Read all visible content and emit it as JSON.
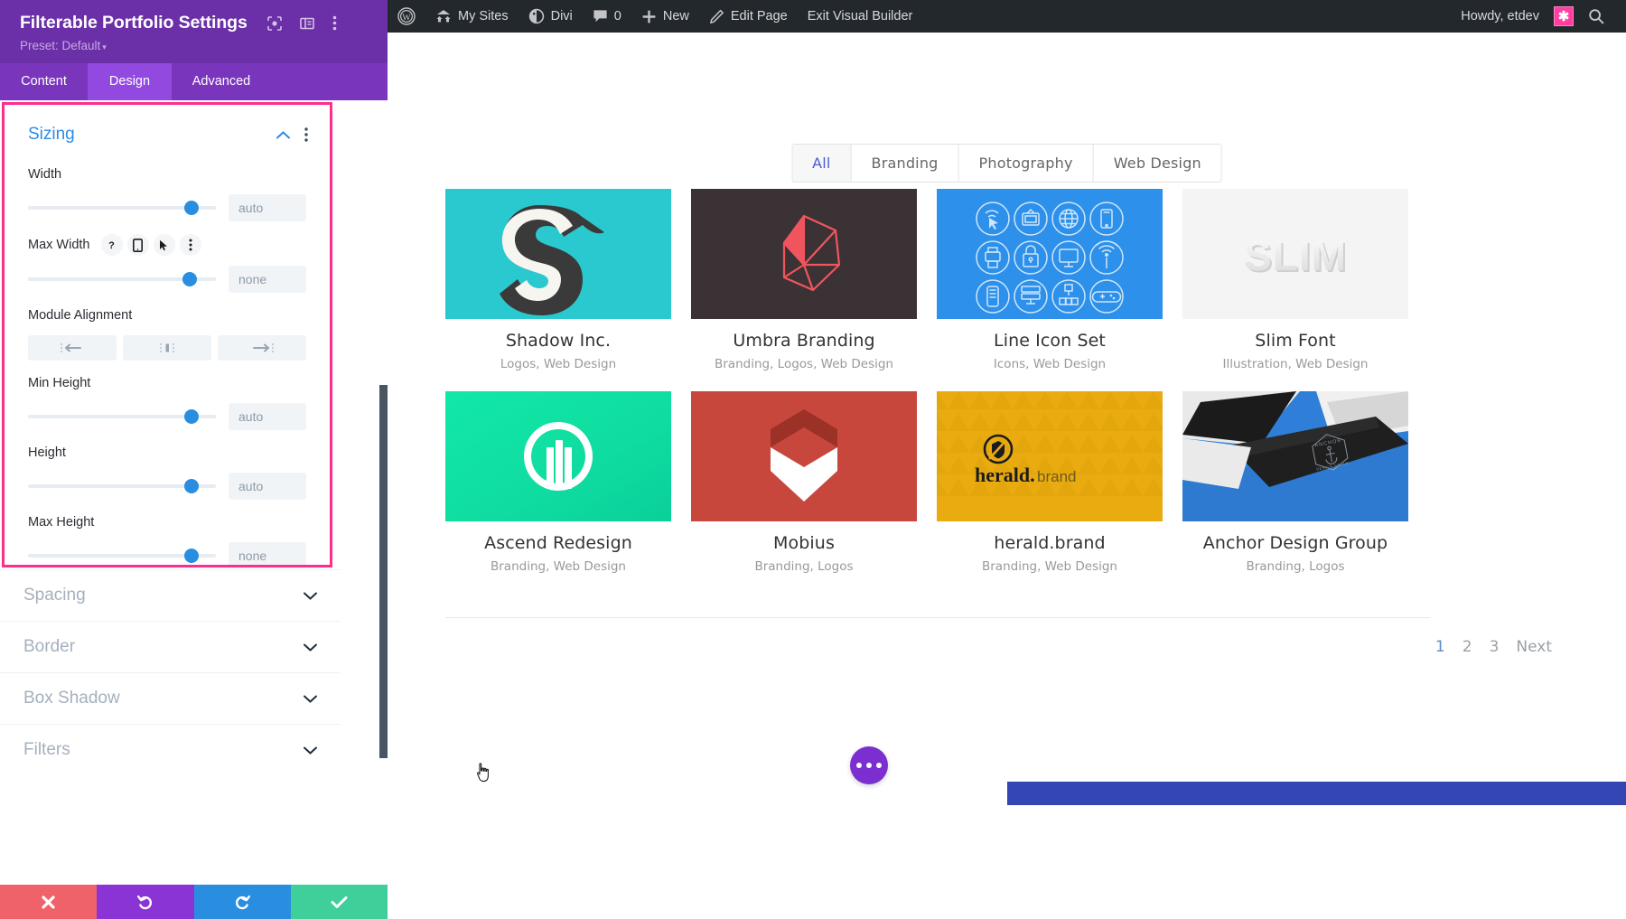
{
  "settings_panel": {
    "title": "Filterable Portfolio Settings",
    "preset_label": "Preset: Default",
    "header_icons": [
      "responsive-view-icon",
      "layout-panel-icon",
      "kebab-menu-icon"
    ],
    "tabs": [
      {
        "label": "Content",
        "active": false
      },
      {
        "label": "Design",
        "active": true
      },
      {
        "label": "Advanced",
        "active": false
      }
    ],
    "open_section": {
      "title": "Sizing",
      "fields": [
        {
          "label": "Width",
          "value": "auto",
          "slider_pct": 83
        },
        {
          "label": "Max Width",
          "value": "none",
          "slider_pct": 82,
          "mini_icons": [
            "help-icon",
            "mobile-icon",
            "cursor-icon",
            "kebab-menu-icon"
          ]
        },
        {
          "label": "Module Alignment",
          "options": [
            "align-left",
            "align-center",
            "align-right"
          ]
        },
        {
          "label": "Min Height",
          "value": "auto",
          "slider_pct": 83
        },
        {
          "label": "Height",
          "value": "auto",
          "slider_pct": 83
        },
        {
          "label": "Max Height",
          "value": "none",
          "slider_pct": 83
        }
      ]
    },
    "collapsed_sections": [
      {
        "label": "Spacing"
      },
      {
        "label": "Border"
      },
      {
        "label": "Box Shadow"
      },
      {
        "label": "Filters"
      }
    ],
    "footer_buttons": [
      {
        "name": "cancel",
        "glyph": "✖",
        "color": "#f0626a"
      },
      {
        "name": "undo",
        "glyph": "↺",
        "color": "#8b34d6"
      },
      {
        "name": "redo",
        "glyph": "↻",
        "color": "#2a8ee0"
      },
      {
        "name": "save",
        "glyph": "✔",
        "color": "#3ecf9a"
      }
    ],
    "colors": {
      "header_bg": "#6b2fa8",
      "tabs_bg": "#7a35bd",
      "active_tab": "#9249e0",
      "highlight": "#ff2d8b",
      "accent_blue": "#2c8de4"
    }
  },
  "admin_bar": {
    "items": [
      {
        "label": "",
        "icon": "wordpress-logo-icon"
      },
      {
        "label": "My Sites",
        "icon": "sites-icon"
      },
      {
        "label": "Divi",
        "icon": "divi-icon"
      },
      {
        "label": "0",
        "icon": "comment-bubble-icon"
      },
      {
        "label": "New",
        "icon": "plus-icon"
      },
      {
        "label": "Edit Page",
        "icon": "pencil-icon"
      },
      {
        "label": "Exit Visual Builder",
        "icon": ""
      }
    ],
    "greeting": "Howdy, etdev",
    "avatar_glyph": "✱",
    "search_icon": "search-icon"
  },
  "portfolio": {
    "filters": [
      {
        "label": "All",
        "active": true
      },
      {
        "label": "Branding",
        "active": false
      },
      {
        "label": "Photography",
        "active": false
      },
      {
        "label": "Web Design",
        "active": false
      }
    ],
    "items": [
      {
        "title": "Shadow Inc.",
        "cats": "Logos, Web Design",
        "thumb": "th-shadow"
      },
      {
        "title": "Umbra Branding",
        "cats": "Branding, Logos, Web Design",
        "thumb": "th-umbra"
      },
      {
        "title": "Line Icon Set",
        "cats": "Icons, Web Design",
        "thumb": "th-icons"
      },
      {
        "title": "Slim Font",
        "cats": "Illustration, Web Design",
        "thumb": "th-slim"
      },
      {
        "title": "Ascend Redesign",
        "cats": "Branding, Web Design",
        "thumb": "th-ascend"
      },
      {
        "title": "Mobius",
        "cats": "Branding, Logos",
        "thumb": "th-mobius"
      },
      {
        "title": "herald.brand",
        "cats": "Branding, Web Design",
        "thumb": "th-herald"
      },
      {
        "title": "Anchor Design Group",
        "cats": "Branding, Logos",
        "thumb": "th-anchor"
      }
    ],
    "pagination": [
      {
        "label": "1",
        "current": true
      },
      {
        "label": "2",
        "current": false
      },
      {
        "label": "3",
        "current": false
      },
      {
        "label": "Next",
        "current": false
      }
    ],
    "herald_logo_text": "herald.",
    "herald_logo_sub": "brand",
    "slim_text": "SLIM",
    "anchor_badge_top": "ANCHOR",
    "anchor_badge_bottom": "DESIGN GROUP"
  },
  "fab": {
    "name": "divi-menu-fab",
    "dots": 3
  }
}
